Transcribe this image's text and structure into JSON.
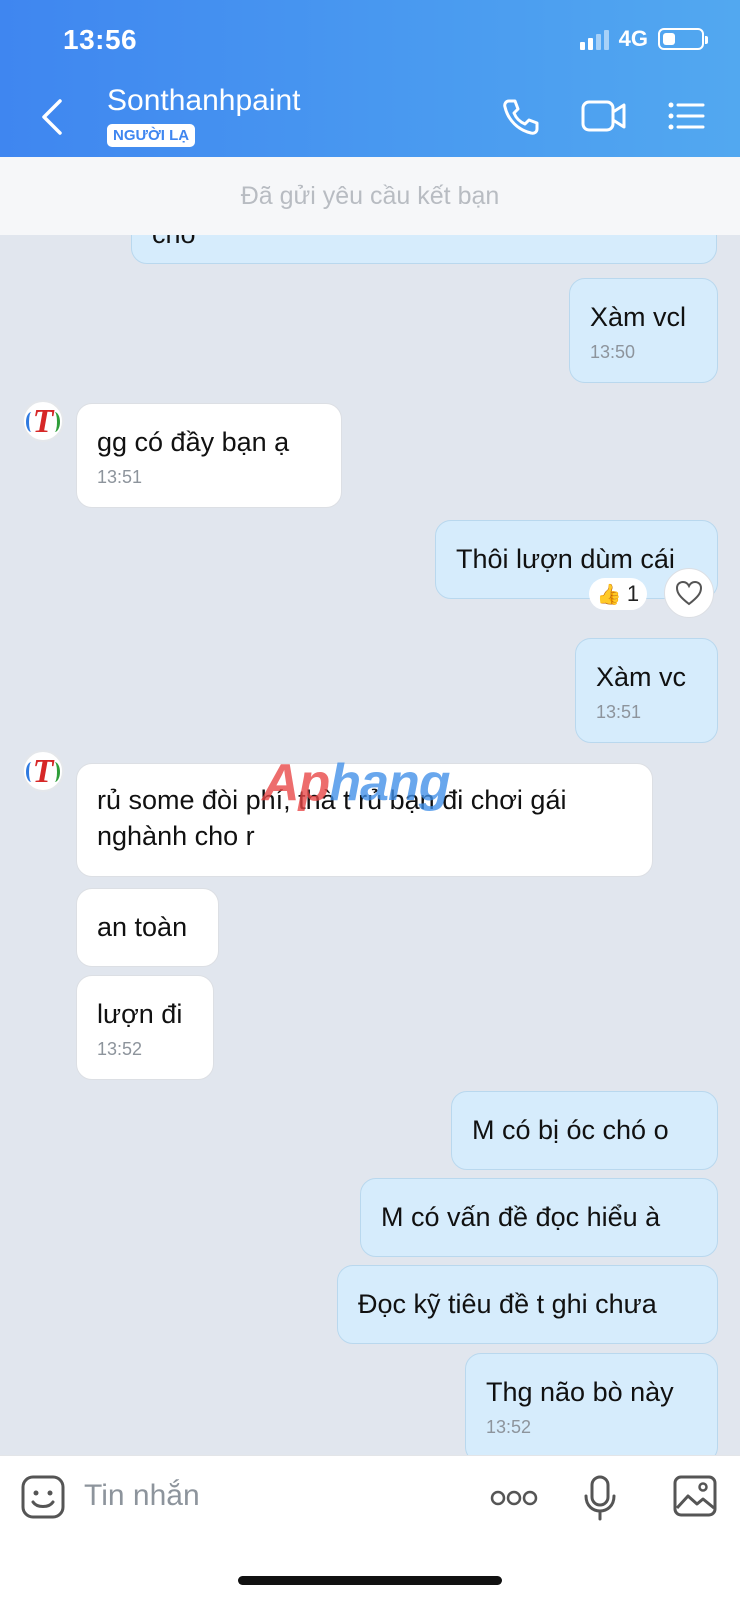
{
  "status": {
    "time": "13:56",
    "network": "4G"
  },
  "header": {
    "contact_name": "Sonthanhpaint",
    "badge": "NGƯỜI LẠ"
  },
  "banner": {
    "text": "Đã gửi yêu cầu kết bạn"
  },
  "messages": [
    {
      "text": "Xàm vcl",
      "time": "13:50"
    },
    {
      "text": "gg có đầy  bạn ạ",
      "time": "13:51"
    },
    {
      "text": "Thôi lượn dùm cái"
    },
    {
      "text": "Xàm vc",
      "time": "13:51"
    },
    {
      "text": "rủ some đòi phí, thà t rủ bạn đi chơi gái nghành cho r"
    },
    {
      "text": "an toàn"
    },
    {
      "text": "lượn đi",
      "time": "13:52"
    },
    {
      "text": "M có bị óc chó o"
    },
    {
      "text": "M có vấn đề đọc hiểu à"
    },
    {
      "text": "Đọc kỹ tiêu đề t ghi chưa"
    },
    {
      "text": "Thg não bò này",
      "time": "13:52"
    }
  ],
  "partial_top_text": "cho",
  "reaction": {
    "emoji": "👍",
    "count": "1"
  },
  "avatar_letter": "T",
  "watermark": {
    "part1": "Ap",
    "part2": "hang"
  },
  "input": {
    "placeholder": "Tin nhắn"
  },
  "colors": {
    "header": "#4a9bf0",
    "my_bubble": "#d6ecfc",
    "their_bubble": "#ffffff",
    "chat_bg": "#e1e6ee"
  }
}
